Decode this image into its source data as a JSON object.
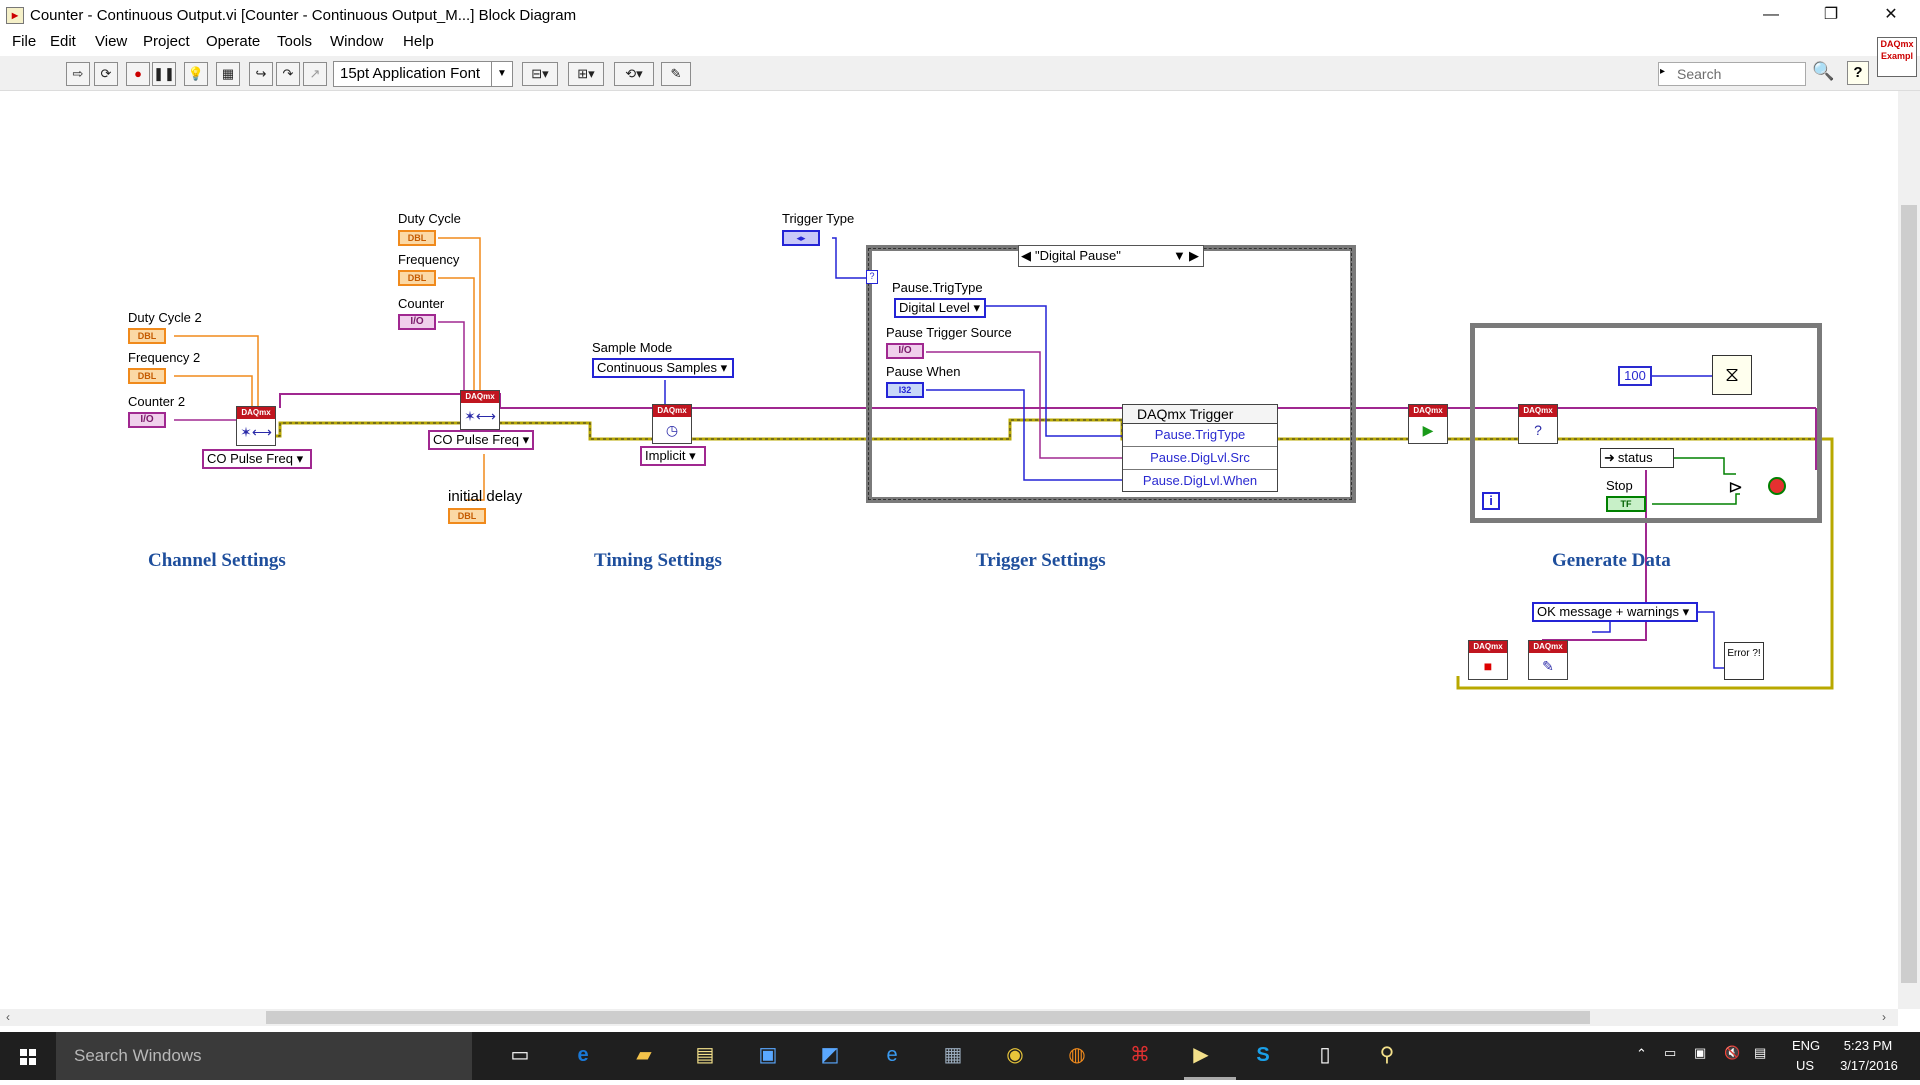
{
  "window": {
    "title": "Counter - Continuous Output.vi [Counter - Continuous Output_M...] Block Diagram",
    "minimize": "—",
    "maximize": "❐",
    "close": "✕"
  },
  "menu": [
    "File",
    "Edit",
    "View",
    "Project",
    "Operate",
    "Tools",
    "Window",
    "Help"
  ],
  "toolbar": {
    "font": "15pt Application Font",
    "search_placeholder": "Search",
    "help": "?",
    "corner_badge": "DAQmx Exampl"
  },
  "diagram": {
    "channel": {
      "duty_cycle_2": "Duty Cycle 2",
      "frequency_2": "Frequency 2",
      "counter_2": "Counter 2",
      "duty_cycle": "Duty Cycle",
      "frequency": "Frequency",
      "counter": "Counter",
      "initial_delay": "initial delay",
      "ring1": "CO Pulse Freq",
      "ring2": "CO Pulse Freq",
      "dbl": "DBL",
      "io": "I/O",
      "section": "Channel Settings"
    },
    "timing": {
      "sample_mode_label": "Sample Mode",
      "sample_mode_value": "Continuous Samples",
      "implicit": "Implicit",
      "section": "Timing Settings"
    },
    "trigger": {
      "trigger_type_label": "Trigger Type",
      "case_selector": "\"Digital Pause\"",
      "pause_trigtype_label": "Pause.TrigType",
      "pause_trigtype_value": "Digital Level",
      "pause_trigger_source": "Pause Trigger Source",
      "pause_when": "Pause When",
      "i32": "I32",
      "node_title": "DAQmx Trigger",
      "prop1": "Pause.TrigType",
      "prop2": "Pause.DigLvl.Src",
      "prop3": "Pause.DigLvl.When",
      "section": "Trigger Settings"
    },
    "generate": {
      "const_100": "100",
      "status": "status",
      "stop_label": "Stop",
      "tf": "TF",
      "loop_i": "i",
      "msg_ring": "OK message + warnings",
      "error_label": "Error ?!",
      "section": "Generate Data"
    },
    "daqmx": "DAQmx"
  },
  "taskbar": {
    "search": "Search Windows",
    "lang": "ENG",
    "region": "US",
    "time": "5:23 PM",
    "date": "3/17/2016"
  }
}
